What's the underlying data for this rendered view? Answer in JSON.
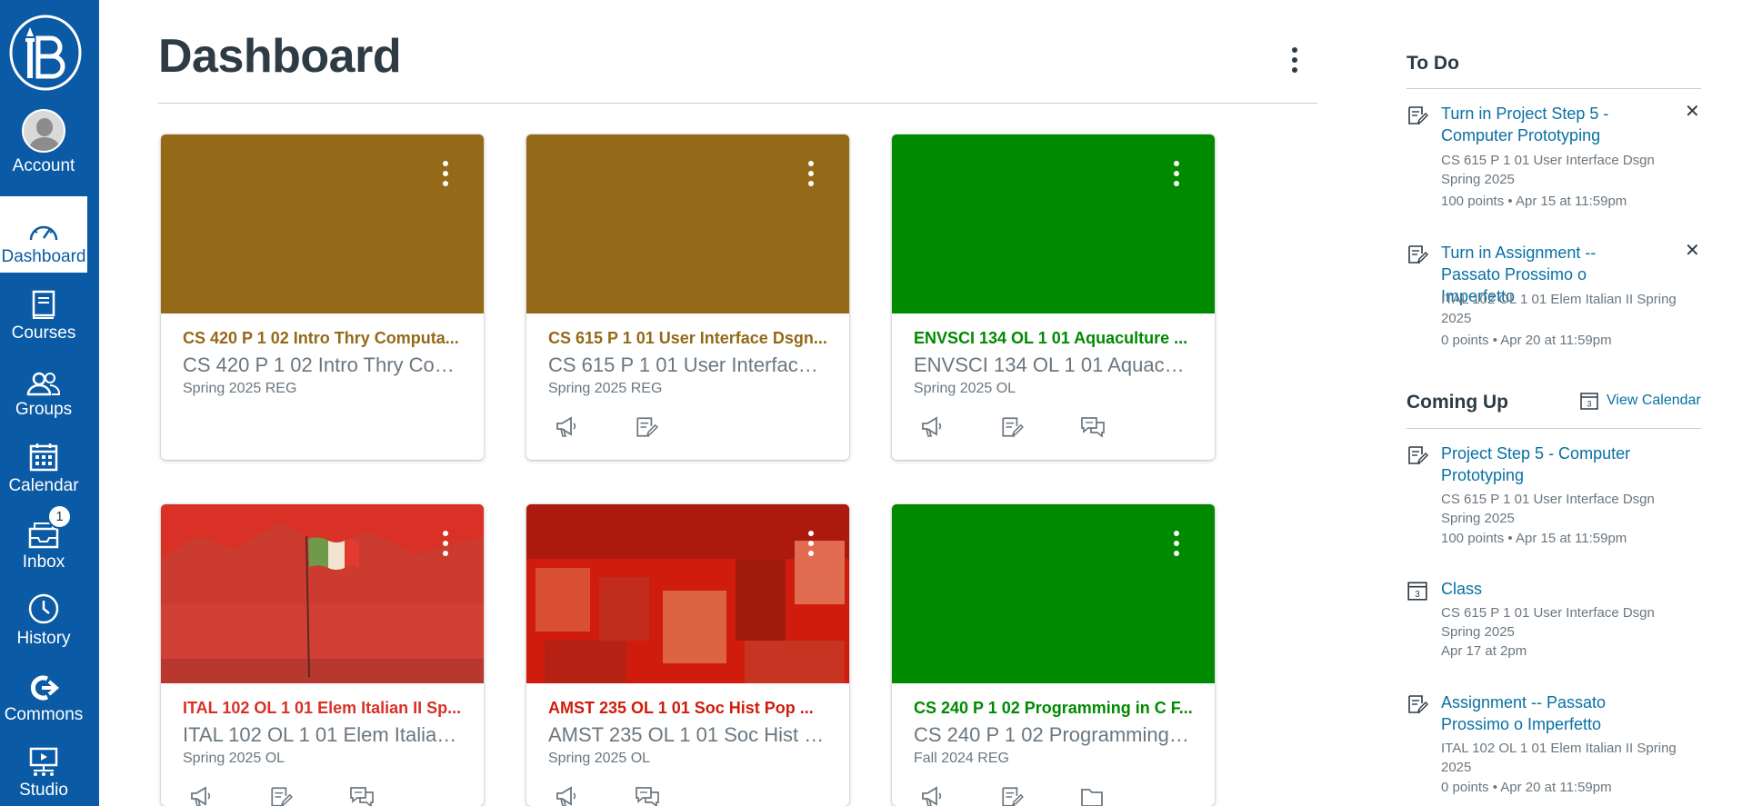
{
  "nav": {
    "items": [
      {
        "label": "Account"
      },
      {
        "label": "Dashboard"
      },
      {
        "label": "Courses"
      },
      {
        "label": "Groups"
      },
      {
        "label": "Calendar"
      },
      {
        "label": "Inbox",
        "badge": "1"
      },
      {
        "label": "History"
      },
      {
        "label": "Commons"
      },
      {
        "label": "Studio"
      }
    ],
    "color": "#0b5aa5"
  },
  "header": {
    "title": "Dashboard"
  },
  "cards": [
    {
      "title": "CS 420 P 1 02 Intro Thry Computa...",
      "subtitle": "CS 420 P 1 02 Intro Thry Com...",
      "term": "Spring 2025 REG",
      "color": "#946918",
      "icons": []
    },
    {
      "title": "CS 615 P 1 01 User Interface Dsgn...",
      "subtitle": "CS 615 P 1 01 User Interface ...",
      "term": "Spring 2025 REG",
      "color": "#946918",
      "icons": [
        "announcements-icon",
        "assignments-icon"
      ]
    },
    {
      "title": "ENVSCI 134 OL 1 01 Aquaculture ...",
      "subtitle": "ENVSCI 134 OL 1 01 Aquacul...",
      "term": "Spring 2025 OL",
      "color": "#008a00",
      "icons": [
        "announcements-icon",
        "assignments-icon",
        "discussions-icon"
      ]
    },
    {
      "title": "ITAL 102 OL 1 01 Elem Italian II Sp...",
      "subtitle": "ITAL 102 OL 1 01 Elem Italian ...",
      "term": "Spring 2025 OL",
      "color": "#d93125",
      "icons": [
        "announcements-icon",
        "assignments-icon",
        "discussions-icon"
      ]
    },
    {
      "title": "AMST 235 OL 1 01 Soc Hist Pop ...",
      "subtitle": "AMST 235 OL 1 01 Soc Hist P...",
      "term": "Spring 2025 OL",
      "color": "#d01c0c",
      "icons": [
        "announcements-icon",
        "discussions-icon"
      ]
    },
    {
      "title": "CS 240 P 1 02 Programming in C F...",
      "subtitle": "CS 240 P 1 02 Programming i...",
      "term": "Fall 2024 REG",
      "color": "#008a00",
      "icons": [
        "announcements-icon",
        "assignments-icon",
        "files-icon"
      ]
    }
  ],
  "todo": {
    "heading": "To Do",
    "items": [
      {
        "title": "Turn in Project Step 5 - Computer Prototyping",
        "course": "CS 615 P 1 01 User Interface Dsgn Spring 2025",
        "meta": "100 points • Apr 15 at 11:59pm"
      },
      {
        "title": "Turn in Assignment -- Passato Prossimo o Imperfetto",
        "course": "ITAL 102 OL 1 01 Elem Italian II Spring 2025",
        "meta": "0 points • Apr 20 at 11:59pm"
      }
    ]
  },
  "coming_up": {
    "heading": "Coming Up",
    "view_calendar": "View Calendar",
    "items": [
      {
        "title": "Project Step 5 - Computer Prototyping",
        "course": "CS 615 P 1 01 User Interface Dsgn Spring 2025",
        "meta": "100 points • Apr 15 at 11:59pm"
      },
      {
        "title": "Class",
        "course": "CS 615 P 1 01 User Interface Dsgn Spring 2025",
        "meta": "Apr 17 at 2pm"
      },
      {
        "title": "Assignment -- Passato Prossimo o Imperfetto",
        "course": "ITAL 102 OL 1 01 Elem Italian II Spring 2025",
        "meta": "0 points • Apr 20 at 11:59pm"
      }
    ]
  }
}
